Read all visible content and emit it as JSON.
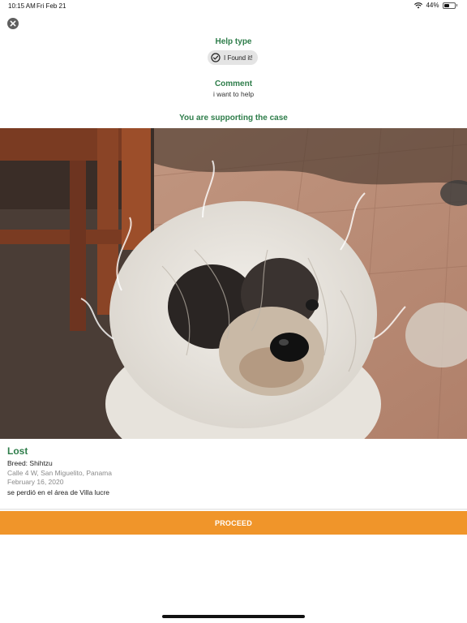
{
  "status_bar": {
    "time": "10:15 AM",
    "date": "Fri Feb 21",
    "battery": "44%",
    "battery_level": 0.44
  },
  "header": {
    "close_icon": "close-circle-icon",
    "help_type_title": "Help type",
    "help_type_chip_icon": "check-circle-icon",
    "help_type_value": "I Found it!",
    "comment_title": "Comment",
    "comment_text": "i want to help",
    "supporting_text": "You are supporting the case"
  },
  "photo": {
    "subject": "dog-photo"
  },
  "case": {
    "status": "Lost",
    "breed": "Breed: Shihtzu",
    "address": "Calle 4 W, San Miguelito, Panama",
    "date": "February 16, 2020",
    "description": "se perdió en el área de Villa lucre"
  },
  "actions": {
    "proceed_label": "PROCEED"
  },
  "colors": {
    "accent_green": "#2e7d4a",
    "proceed_orange": "#f0952a"
  }
}
